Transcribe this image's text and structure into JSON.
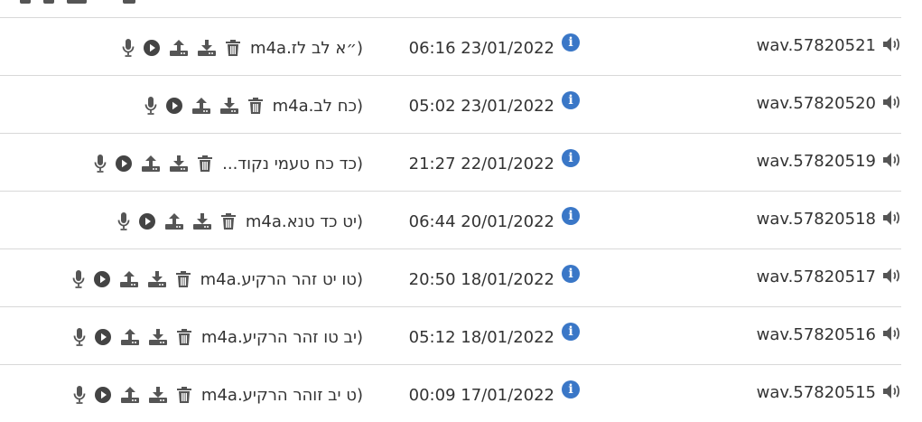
{
  "recordings": [
    {
      "filename": "wav.57820521",
      "datetime": "06:16 23/01/2022",
      "title": "(״א לב לז.m4a"
    },
    {
      "filename": "wav.57820520",
      "datetime": "05:02 23/01/2022",
      "title": "(כח לב.m4a"
    },
    {
      "filename": "wav.57820519",
      "datetime": "21:27 22/01/2022",
      "title": "(כד כח טעמי נקוד..."
    },
    {
      "filename": "wav.57820518",
      "datetime": "06:44 20/01/2022",
      "title": "(יט כד טנא.m4a"
    },
    {
      "filename": "wav.57820517",
      "datetime": "20:50 18/01/2022",
      "title": "(טו יט זהר הרקיע.m4a"
    },
    {
      "filename": "wav.57820516",
      "datetime": "05:12 18/01/2022",
      "title": "(יב טו זהר הרקיע.m4a"
    },
    {
      "filename": "wav.57820515",
      "datetime": "00:09 17/01/2022",
      "title": "(ט יב זוהר הרקיע.m4a"
    }
  ],
  "icons": {
    "speaker": "speaker-icon",
    "info": "info-icon",
    "microphone": "microphone-icon",
    "play": "play-icon",
    "upload": "upload-icon",
    "download": "download-icon",
    "trash": "trash-icon"
  },
  "colors": {
    "info_blue": "#3a77c7",
    "icon_gray": "#555555",
    "divider": "#d8d8d8"
  }
}
